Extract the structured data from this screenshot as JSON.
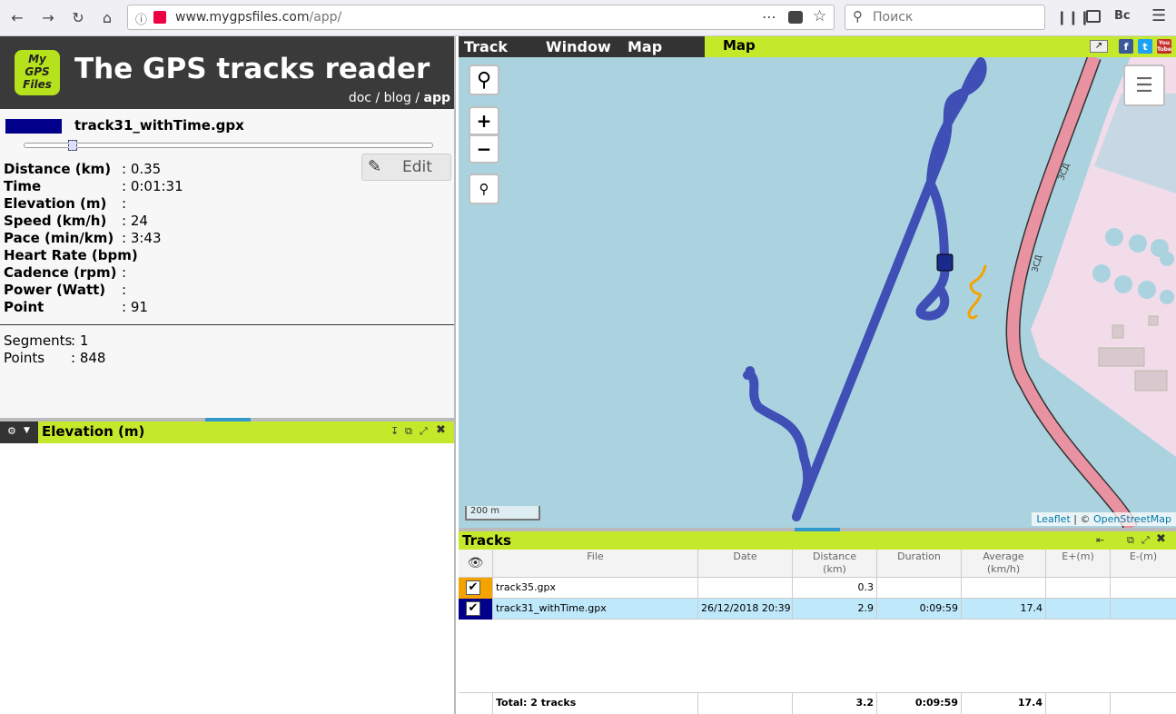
{
  "browser": {
    "url_host": "www.mygpsfiles.com",
    "url_path": "/app/",
    "search_placeholder": "Поиск"
  },
  "header": {
    "logo_lines": [
      "My",
      "GPS",
      "Files"
    ],
    "title": "The GPS tracks reader",
    "links": {
      "doc": "doc",
      "sep1": " / ",
      "blog": "blog",
      "sep2": " / ",
      "app": "app"
    }
  },
  "track": {
    "name": "track31_withTime.gpx",
    "color": "#00008b",
    "edit_label": "Edit",
    "slider_position": 0.12,
    "stats": [
      {
        "label": "Distance (km)",
        "value": ": 0.35"
      },
      {
        "label": "Time",
        "value": ": 0:01:31"
      },
      {
        "label": "Elevation (m)",
        "value": ":"
      },
      {
        "label": "Speed (km/h)",
        "value": ": 24"
      },
      {
        "label": "Pace (min/km)",
        "value": ": 3:43"
      },
      {
        "label": "Heart Rate (bpm)",
        "value": ":"
      },
      {
        "label": "Cadence (rpm)",
        "value": ":"
      },
      {
        "label": "Power (Watt)",
        "value": ":"
      },
      {
        "label": "Point",
        "value": ": 91"
      }
    ],
    "summary": [
      {
        "label": "Segments",
        "value": ": 1"
      },
      {
        "label": "Points",
        "value": ": 848"
      }
    ]
  },
  "elevation_panel": {
    "title": "Elevation (m)"
  },
  "menu": {
    "items": [
      "Track",
      "Window",
      "Map"
    ]
  },
  "map": {
    "tab_title": "Map",
    "scale_label": "200 m",
    "attribution_leaflet": "Leaflet",
    "attribution_sep": " | © ",
    "attribution_osm": "OpenStreetMap",
    "road_label": "ЗСД",
    "zoom_in": "+",
    "zoom_out": "−",
    "social": [
      "f",
      "t",
      "You Tube"
    ]
  },
  "tracks_panel": {
    "title": "Tracks",
    "columns": [
      "File",
      "Date",
      "Distance\n(km)",
      "Duration",
      "Average\n(km/h)",
      "E+(m)",
      "E-(m)"
    ],
    "rows": [
      {
        "color": "#f5a300",
        "checked": true,
        "file": "track35.gpx",
        "date": "",
        "distance": "0.3",
        "duration": "",
        "average": "",
        "eplus": "",
        "eminus": ""
      },
      {
        "color": "#00008b",
        "checked": true,
        "file": "track31_withTime.gpx",
        "date": "26/12/2018 20:39",
        "distance": "2.9",
        "duration": "0:09:59",
        "average": "17.4",
        "eplus": "",
        "eminus": ""
      }
    ],
    "totals": {
      "label": "Total: 2 tracks",
      "distance": "3.2",
      "duration": "0:09:59",
      "average": "17.4"
    }
  },
  "colors": {
    "accent": "#c4e82a",
    "header_bg": "#3a3a3a",
    "water": "#aad3df",
    "track_blue": "#3f4fb5",
    "track_orange": "#f5a300",
    "road": "#e892a2"
  }
}
